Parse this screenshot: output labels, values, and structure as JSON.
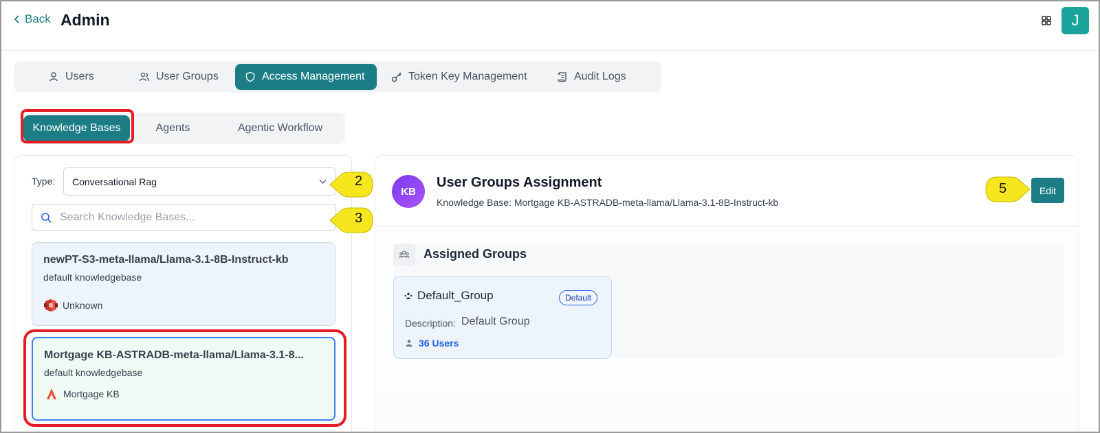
{
  "header": {
    "back_label": "Back",
    "title": "Admin",
    "avatar_initial": "J"
  },
  "main_tabs": [
    {
      "label": "Users",
      "icon": "user-icon"
    },
    {
      "label": "User Groups",
      "icon": "users-icon"
    },
    {
      "label": "Access Management",
      "icon": "shield-icon",
      "active": true
    },
    {
      "label": "Token Key Management",
      "icon": "key-icon"
    },
    {
      "label": "Audit Logs",
      "icon": "scroll-icon"
    }
  ],
  "sub_tabs": [
    {
      "label": "Knowledge Bases",
      "active": true
    },
    {
      "label": "Agents"
    },
    {
      "label": "Agentic Workflow"
    }
  ],
  "filters": {
    "type_label": "Type:",
    "type_value": "Conversational Rag",
    "search_placeholder": "Search Knowledge Bases..."
  },
  "kb_list": [
    {
      "name": "newPT-S3-meta-llama/Llama-3.1-8B-Instruct-kb",
      "desc": "default knowledgebase",
      "source": "Unknown",
      "icon": "aws-s3-icon"
    },
    {
      "name": "Mortgage KB-ASTRADB-meta-llama/Llama-3.1-8...",
      "desc": "default knowledgebase",
      "source": "Mortgage KB",
      "icon": "astradb-icon",
      "selected": true
    }
  ],
  "callouts": {
    "c2": "2",
    "c3": "3",
    "c5": "5"
  },
  "detail": {
    "badge": "KB",
    "title": "User Groups Assignment",
    "subtitle": "Knowledge Base: Mortgage KB-ASTRADB-meta-llama/Llama-3.1-8B-Instruct-kb",
    "edit_label": "Edit",
    "assigned_title": "Assigned Groups",
    "group": {
      "name": "Default_Group",
      "badge": "Default",
      "desc_label": "Description:",
      "desc_value": "Default Group",
      "users": "36 Users"
    }
  },
  "colors": {
    "accent": "#1c7d86",
    "highlight_red": "#e41e24",
    "callout_yellow": "#f5e61d",
    "link_blue": "#2563eb"
  }
}
